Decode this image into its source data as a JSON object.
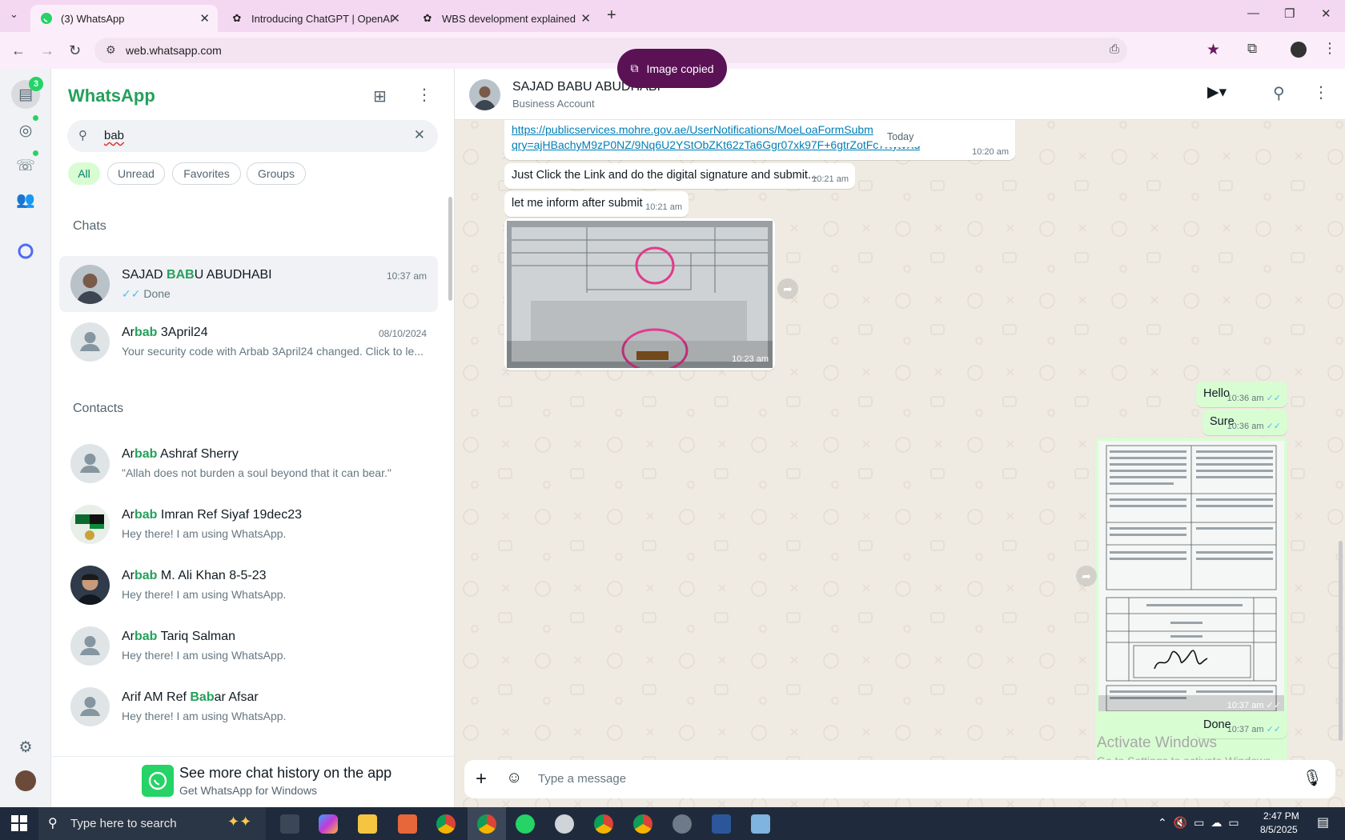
{
  "browser": {
    "tabs": [
      {
        "title": "(3) WhatsApp",
        "active": true
      },
      {
        "title": "Introducing ChatGPT | OpenAI",
        "active": false
      },
      {
        "title": "WBS development explained",
        "active": false
      }
    ],
    "url": "web.whatsapp.com",
    "toast": "Image copied"
  },
  "rail": {
    "badge": "3"
  },
  "sidebar": {
    "brand": "WhatsApp",
    "search_value": "bab",
    "filters": [
      "All",
      "Unread",
      "Favorites",
      "Groups"
    ],
    "chats_header": "Chats",
    "contacts_header": "Contacts",
    "chats": [
      {
        "name_pre": "SAJAD ",
        "name_hl": "BAB",
        "name_post": "U ABUDHABI",
        "time": "10:37 am",
        "preview": "Done"
      },
      {
        "name_pre": "Ar",
        "name_hl": "bab",
        "name_post": " 3April24",
        "time": "08/10/2024",
        "preview": "Your security code with Arbab 3April24 changed. Click to le..."
      }
    ],
    "contacts": [
      {
        "name_pre": "Ar",
        "name_hl": "bab",
        "name_post": " Ashraf Sherry",
        "status": "\"Allah does not burden a soul beyond that it can bear.\""
      },
      {
        "name_pre": "Ar",
        "name_hl": "bab",
        "name_post": " Imran Ref Siyaf 19dec23",
        "status": "Hey there! I am using WhatsApp."
      },
      {
        "name_pre": "Ar",
        "name_hl": "bab",
        "name_post": " M. Ali Khan 8-5-23",
        "status": "Hey there! I am using WhatsApp."
      },
      {
        "name_pre": "Ar",
        "name_hl": "bab",
        "name_post": " Tariq Salman",
        "status": "Hey there! I am using WhatsApp."
      },
      {
        "name_pre": "Arif AM Ref ",
        "name_hl": "Bab",
        "name_post": "ar Afsar",
        "status": "Hey there! I am using WhatsApp."
      }
    ],
    "promo_title": "See more chat history on the app",
    "promo_sub": "Get WhatsApp for Windows"
  },
  "chat": {
    "contact_name": "SAJAD BABU ABUDHABI",
    "contact_sub": "Business Account",
    "date_chip": "Today",
    "link_line1": "https://publicservices.mohre.gov.ae/UserNotifications/MoeLoaFormSubm",
    "link_line2": "qry=ajHBachyM9zP0NZ/9Nq6U2YStObZKt62zTa6Ggr07xk97F+6gtrZotFc7KytvXd3",
    "link_time": "10:20 am",
    "msg2": "Just Click the Link and do the digital signature and submit...",
    "msg2_time": "10:21 am",
    "msg3": "let me inform after submit",
    "msg3_time": "10:21 am",
    "img_time": "10:23 am",
    "out1": "Hello",
    "out1_time": "10:36 am",
    "out2": "Sure",
    "out2_time": "10:36 am",
    "out_img_time": "10:37 am",
    "out3": "Done",
    "out3_time": "10:37 am",
    "composer_placeholder": "Type a message"
  },
  "watermark": {
    "line1": "Activate Windows",
    "line2": "Go to Settings to activate Windows."
  },
  "taskbar": {
    "search_placeholder": "Type here to search",
    "time": "2:47 PM",
    "date": "8/5/2025"
  }
}
